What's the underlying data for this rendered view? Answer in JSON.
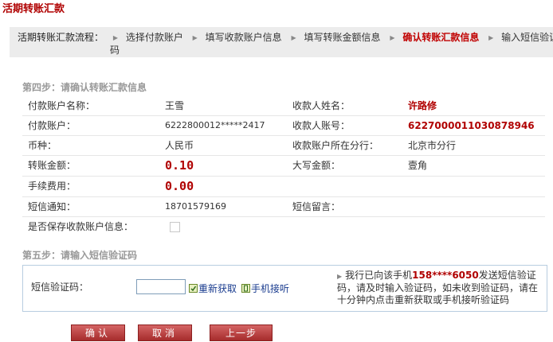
{
  "page_title": "活期转账汇款",
  "flow": {
    "label": "活期转账汇款流程：",
    "steps": [
      "选择付款账户",
      "填写收款账户信息",
      "填写转账金额信息",
      "确认转账汇款信息",
      "输入短信验证"
    ],
    "wrap_char": "码",
    "current_index": 3
  },
  "step4": {
    "title": "第四步：请确认转账汇款信息",
    "rows": {
      "payer_name_label": "付款账户名称：",
      "payer_name": "王雪",
      "payee_name_label": "收款人姓名：",
      "payee_name": "许路修",
      "payer_account_label": "付款账户：",
      "payer_account": "6222800012*****2417",
      "payee_account_label": "收款人账号：",
      "payee_account": "6227000011030878946",
      "currency_label": "币种：",
      "currency": "人民币",
      "payee_branch_label": "收款账户所在分行：",
      "payee_branch": "北京市分行",
      "amount_label": "转账金额：",
      "amount": "0.10",
      "amount_words_label": "大写金额：",
      "amount_words": "壹角",
      "fee_label": "手续费用：",
      "fee": "0.00",
      "sms_notify_label": "短信通知：",
      "sms_notify": "18701579169",
      "sms_message_label": "短信留言：",
      "sms_message": "",
      "save_payee_label": "是否保存收款账户信息："
    }
  },
  "step5": {
    "title": "第五步：请输入短信验证码",
    "code_label": "短信验证码：",
    "code_value": "",
    "resend_label": "重新获取",
    "phone_listen_label": "手机接听",
    "notice_prefix": "我行已向该手机",
    "notice_phone": "158****6050",
    "notice_suffix": "发送短信验证码，请及时输入验证码，如未收到验证码，请在十分钟内点击重新获取或手机接听验证码"
  },
  "buttons": {
    "confirm": "确认",
    "cancel": "取消",
    "prev": "上一步"
  },
  "colors": {
    "accent_red": "#b00000",
    "button_red": "#b43c3c",
    "link_blue": "#1a3c8f",
    "flow_bg": "#ececec"
  }
}
